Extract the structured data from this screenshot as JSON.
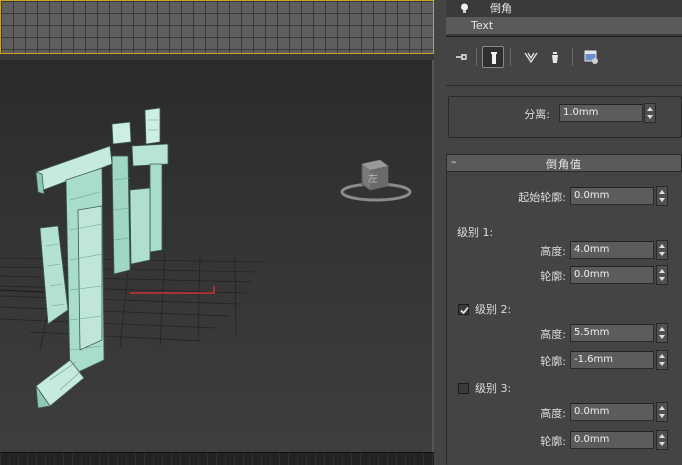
{
  "modifier_stack": {
    "items": [
      {
        "label": "倒角",
        "icon": "lightbulb-icon"
      },
      {
        "label": "Text"
      }
    ]
  },
  "toolbar": {
    "icons": [
      "pin-stack-icon",
      "show-end-result-icon",
      "make-unique-icon",
      "remove-modifier-icon",
      "configure-modifier-sets-icon"
    ]
  },
  "separation": {
    "label": "分离:",
    "value": "1.0mm"
  },
  "bevel_values": {
    "title": "倒角值",
    "collapse_symbol": "–",
    "start_outline": {
      "label": "起始轮廓:",
      "value": "0.0mm"
    },
    "level1": {
      "label": "级别 1:",
      "height_label": "高度:",
      "height_value": "4.0mm",
      "outline_label": "轮廓:",
      "outline_value": "0.0mm"
    },
    "level2": {
      "label": "级别 2:",
      "checked": true,
      "height_label": "高度:",
      "height_value": "5.5mm",
      "outline_label": "轮廓:",
      "outline_value": "-1.6mm"
    },
    "level3": {
      "label": "级别 3:",
      "checked": false,
      "height_label": "高度:",
      "height_value": "0.0mm",
      "outline_label": "轮廓:",
      "outline_value": "0.0mm"
    }
  },
  "viewcube": {
    "face_label": "左"
  },
  "colors": {
    "viewport_active_border": "#c9a227",
    "mesh_fill": "#a8dccb",
    "axis_x": "#c83232"
  }
}
